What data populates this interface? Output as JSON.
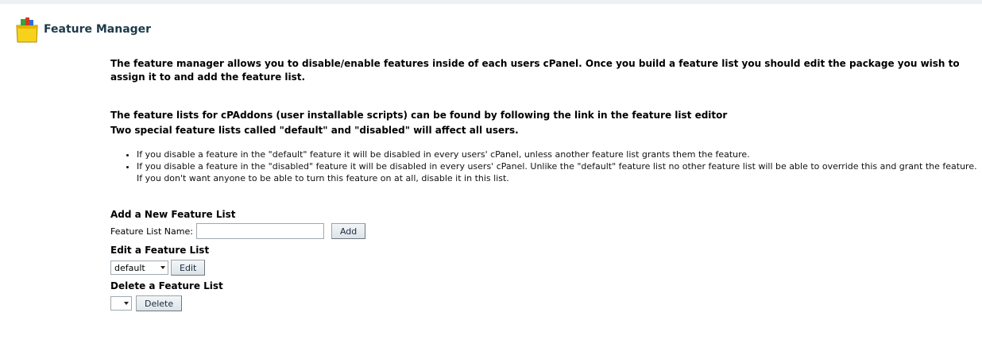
{
  "header": {
    "title": "Feature Manager",
    "icon": "shopping-bag-icon"
  },
  "intro": {
    "text": "The feature manager allows you to disable/enable features inside of each users cPanel. Once you build a feature list you should edit the package you wish to assign it to and add the feature list."
  },
  "notes": {
    "line1": "The feature lists for cPAddons (user installable scripts) can be found by following the link in the feature list editor",
    "line2": "Two special feature lists called \"default\" and \"disabled\" will affect all users."
  },
  "bullets": [
    "If you disable a feature in the \"default\" feature it will be disabled in every users' cPanel, unless another feature list grants them the feature.",
    "If you disable a feature in the \"disabled\" feature it will be disabled in every users' cPanel. Unlike the \"default\" feature list no other feature list will be able to override this and grant the feature. If you don't want anyone to be able to turn this feature on at all, disable it in this list."
  ],
  "add_section": {
    "title": "Add a New Feature List",
    "label": "Feature List Name:",
    "input_value": "",
    "button": "Add"
  },
  "edit_section": {
    "title": "Edit a Feature List",
    "selected": "default",
    "button": "Edit"
  },
  "delete_section": {
    "title": "Delete a Feature List",
    "selected": "",
    "button": "Delete"
  }
}
